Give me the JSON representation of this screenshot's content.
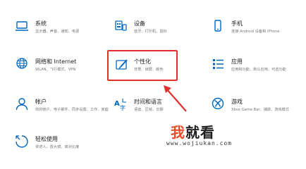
{
  "colors": {
    "accent": "#0067c0",
    "highlight": "#e0302c",
    "watermark_red": "#e84e2a"
  },
  "tiles": [
    {
      "title": "系统",
      "desc": "显示器、声音、通知、电源",
      "icon": "laptop-icon"
    },
    {
      "title": "设备",
      "desc": "蓝牙、打印机、鼠标",
      "icon": "keyboard-printer-icon"
    },
    {
      "title": "手机",
      "desc": "连接 Android 设备和 iPhone",
      "icon": "phone-icon"
    },
    {
      "title": "网络和 Internet",
      "desc": "WLAN、飞行模式、VPN",
      "icon": "globe-icon"
    },
    {
      "title": "个性化",
      "desc": "背景、锁屏、颜色",
      "icon": "paint-icon"
    },
    {
      "title": "应用",
      "desc": "应用和功能、默认应用、可选功能",
      "icon": "apps-list-icon"
    },
    {
      "title": "帐户",
      "desc": "你的帐户、电子邮件、同步设置、工作、家庭",
      "icon": "person-icon"
    },
    {
      "title": "时间和语言",
      "desc": "语音、区域、日期",
      "icon": "time-language-icon"
    },
    {
      "title": "游戏",
      "desc": "Xbox Game Bar、捕获、游戏模式",
      "icon": "xbox-icon"
    },
    {
      "title": "轻松使用",
      "desc": "讲述人、放大镜、高对比度",
      "icon": "ease-of-access-icon"
    }
  ],
  "watermark": {
    "text_red": "我",
    "text_dark": "就看",
    "url": "www.wojiukan.com"
  }
}
